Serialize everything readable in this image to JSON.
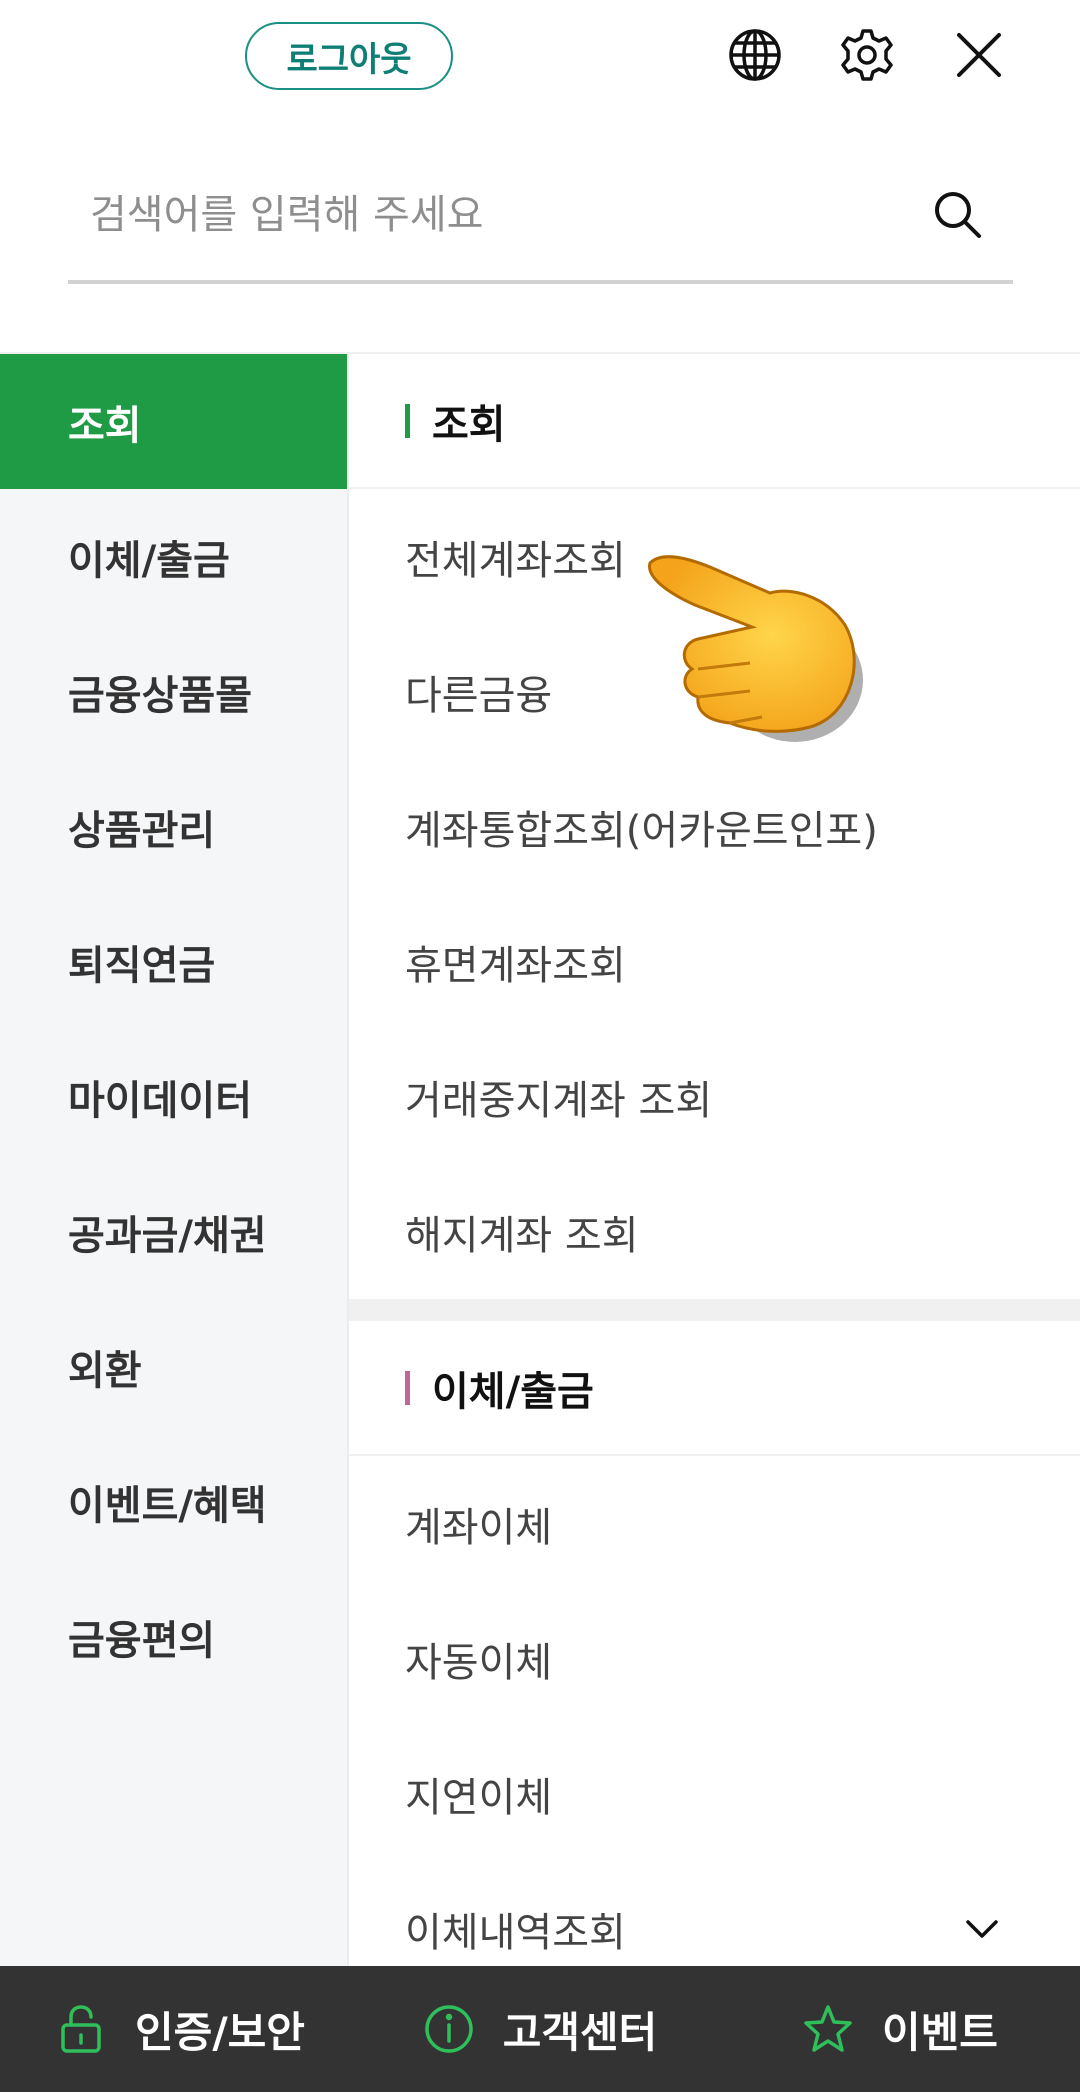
{
  "header": {
    "logout_label": "로그아웃",
    "icons": [
      "globe-icon",
      "gear-icon",
      "close-icon"
    ]
  },
  "search": {
    "placeholder": "검색어를 입력해 주세요",
    "icon": "search-icon"
  },
  "leftnav": {
    "items": [
      {
        "label": "조회",
        "active": true
      },
      {
        "label": "이체/출금"
      },
      {
        "label": "금융상품몰"
      },
      {
        "label": "상품관리"
      },
      {
        "label": "퇴직연금"
      },
      {
        "label": "마이데이터"
      },
      {
        "label": "공과금/채권"
      },
      {
        "label": "외환"
      },
      {
        "label": "이벤트/혜택"
      },
      {
        "label": "금융편의"
      }
    ]
  },
  "sections": [
    {
      "title": "조회",
      "accent": "#1f9a45",
      "items": [
        "전체계좌조회",
        "다른금융",
        "계좌통합조회(어카운트인포)",
        "휴면계좌조회",
        "거래중지계좌 조회",
        "해지계좌 조회"
      ]
    },
    {
      "title": "이체/출금",
      "accent": "#c0679a",
      "items": [
        "계좌이체",
        "자동이체",
        "지연이체",
        "이체내역조회"
      ]
    }
  ],
  "bottombar": {
    "items": [
      {
        "label": "인증/보안",
        "icon": "lock-icon"
      },
      {
        "label": "고객센터",
        "icon": "info-icon"
      },
      {
        "label": "이벤트",
        "icon": "star-icon"
      }
    ]
  },
  "colors": {
    "primary_green": "#1f9a45",
    "logout_teal": "#1a8f83",
    "bottombar_bg": "#333333"
  }
}
